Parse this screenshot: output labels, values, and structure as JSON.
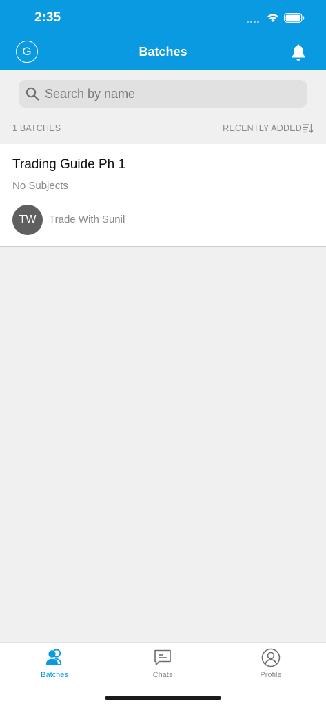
{
  "status_bar": {
    "time": "2:35"
  },
  "header": {
    "avatar_letter": "G",
    "title": "Batches",
    "notification_icon": "bell-icon"
  },
  "search": {
    "placeholder": "Search by name",
    "value": ""
  },
  "list_meta": {
    "count_label": "1 BATCHES",
    "sort_label": "RECENTLY ADDED"
  },
  "batches": [
    {
      "title": "Trading Guide Ph 1",
      "subjects": "No Subjects",
      "teacher_initials": "TW",
      "teacher_name": "Trade With Sunil"
    }
  ],
  "tabs": [
    {
      "label": "Batches",
      "icon": "batches-icon",
      "active": true
    },
    {
      "label": "Chats",
      "icon": "chat-icon",
      "active": false
    },
    {
      "label": "Profile",
      "icon": "profile-icon",
      "active": false
    }
  ],
  "colors": {
    "accent": "#0a9ae2",
    "background": "#f0f0f0",
    "avatar": "#5f5f5f"
  }
}
